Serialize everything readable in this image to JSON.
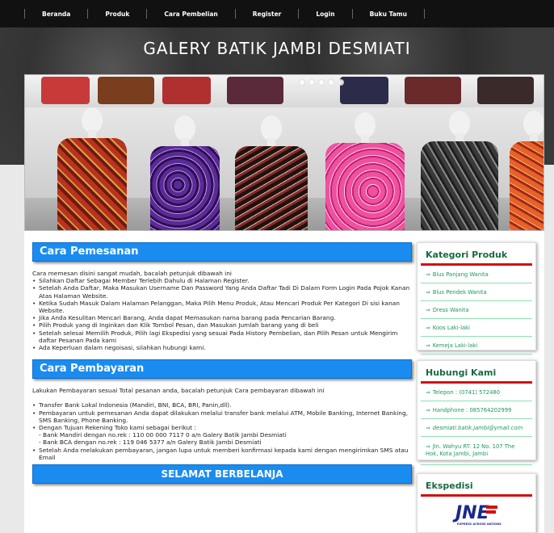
{
  "nav": {
    "items": [
      "Beranda",
      "Produk",
      "Cara Pembelian",
      "Register",
      "Login",
      "Buku Tamu"
    ]
  },
  "site": {
    "title": "GALERY BATIK JAMBI DESMIATI"
  },
  "pemesanan": {
    "title": "Cara Pemesanan",
    "intro": "Cara memesan disini sangat mudah, bacalah petunjuk dibawah ini",
    "steps": [
      "Silahkan Daftar Sebagai Member Terlebih Dahulu di Halaman Register.",
      "Setelah Anda Daftar, Maka Masukan Username Dan Password Yang Anda Daftar Tadi Di Dalam Form Login Pada Pojok Kanan Atas Halaman Website.",
      "Ketika Sudah Masuk Dalam Halaman Pelanggan, Maka Pilih Menu Produk, Atau Mencari Produk Per Kategori Di sisi kanan Website.",
      "Jika Anda Kesulitan Mencari Barang, Anda dapat Memasukan nama barang pada Pencarian Barang.",
      "Pilih Produk yang di Inginkan dan Klik Tombol Pesan, dan Masukan Jumlah barang yang di beli",
      "Setelah selesai Memilih Produk, Pilih lagi Ekspedisi yang sesuai Pada History Pembelian, dan Pilih Pesan untuk Mengirim daftar Pesanan Pada kami",
      "Ada Keperluan dalam negoisasi, silahkan hubungi kami."
    ]
  },
  "pembayaran": {
    "title": "Cara Pembayaran",
    "intro": "Lakukan Pembayaran sesuai Total pesanan anda, bacalah petunjuk Cara pembayaran dibawah ini",
    "steps": [
      "Transfer Bank Lokal Indonesia (Mandiri, BNI, BCA, BRI, Panin,dll).",
      "Pembayaran untuk pemesanan Anda dapat dilakukan melalui transfer bank melalui ATM, Mobile Banking, Internet Banking, SMS Banking, Phone Banking.",
      "Dengan Tujuan Rekening Toko kami sebagai berikut :",
      "Setelah Anda melakukan pembayaran, jangan lupa untuk memberi konfirmasi kepada kami dengan mengirimkan SMS atau Email"
    ],
    "accounts": [
      "- Bank Mandiri dengan no.rek : 110 00 000 7117 0 a/n Galery Batik Jambi Desmiati",
      "- Bank BCA dengan no.rek : 119 046 5377 a/n Galery Batik Jambi Desmiati"
    ],
    "closing": "SELAMAT BERBELANJA"
  },
  "kategori": {
    "title": "Kategori Produk",
    "items": [
      "Blus Panjang Wanita",
      "Blus Pendek Wanita",
      "Dress Wanita",
      "Koos Laki-laki",
      "Kemeja Laki-laki"
    ]
  },
  "hubungi": {
    "title": "Hubungi Kami",
    "items": [
      "Telepon : (0741) 572480",
      "Handphone : 085764202999",
      "desmiati.batik.jambi@ymail.com",
      "Jln. Wahyu RT. 12 No. 107 The Hok, Kota Jambi, Jambi"
    ]
  },
  "ekspedisi": {
    "title": "Ekspedisi",
    "logo_text": "JNE",
    "logo_tagline": "EXPRESS ACROSS NATIONS"
  },
  "colors": {
    "accent_blue": "#1a8cf0",
    "sidebar_red": "#d21010",
    "sidebar_green": "#1a9a5a"
  }
}
